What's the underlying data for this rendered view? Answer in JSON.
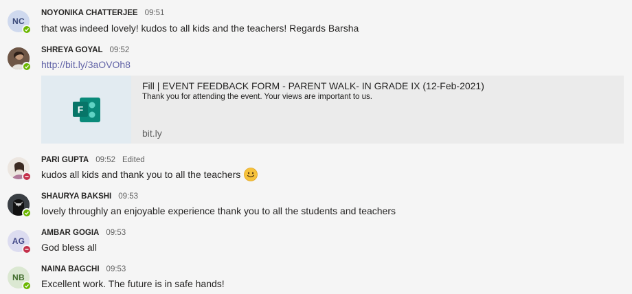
{
  "colors": {
    "background": "#f5f5f5",
    "link": "#6264a7",
    "available": "#6bb700",
    "busy": "#c4314b",
    "card_bg": "#ebebeb",
    "forms_teal": "#077568"
  },
  "messages": [
    {
      "author": "NOYONIKA CHATTERJEE",
      "time": "09:51",
      "text": "that was indeed lovely! kudos to all kids and the teachers! Regards Barsha",
      "avatar_initials": "NC",
      "presence": "available"
    },
    {
      "author": "SHREYA GOYAL",
      "time": "09:52",
      "link_text": "http://bit.ly/3aOVOh8",
      "presence": "available",
      "preview_card": {
        "icon": "microsoft-forms-icon",
        "title": "Fill | EVENT FEEDBACK FORM - PARENT WALK- IN GRADE IX (12-Feb-2021)",
        "description": "Thank you for attending the event. Your views are important to us.",
        "domain": "bit.ly"
      }
    },
    {
      "author": "PARI GUPTA",
      "time": "09:52",
      "edited": "Edited",
      "text": "kudos all kids and thank you to all the teachers",
      "emoji": "smiley-emoji",
      "presence": "busy"
    },
    {
      "author": "SHAURYA BAKSHI",
      "time": "09:53",
      "text": "lovely throughly an enjoyable experience thank you to all the students and teachers",
      "presence": "available"
    },
    {
      "author": "AMBAR GOGIA",
      "time": "09:53",
      "text": "God bless all",
      "avatar_initials": "AG",
      "presence": "busy"
    },
    {
      "author": "NAINA BAGCHI",
      "time": "09:53",
      "text": "Excellent work. The future is in safe hands!",
      "avatar_initials": "NB",
      "presence": "available"
    }
  ]
}
